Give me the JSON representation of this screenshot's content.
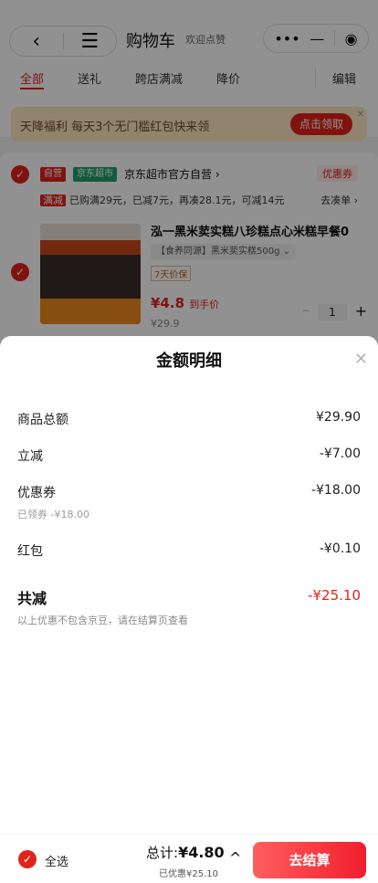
{
  "background": {
    "header": {
      "title": "购物车",
      "location": "欢迎点赞",
      "back_icon": "‹",
      "menu_icon": "☰",
      "capsule": {
        "more": "•••",
        "minimize": "—",
        "target": "◉"
      }
    },
    "tabs": [
      {
        "label": "全部",
        "active": true
      },
      {
        "label": "送礼",
        "active": false
      },
      {
        "label": "跨店满减",
        "active": false
      },
      {
        "label": "降价",
        "active": false
      }
    ],
    "edit_label": "编辑",
    "banner": {
      "text": "天降福利 每天3个无门槛红包快来领",
      "button": "点击领取",
      "close": "✕"
    },
    "store": {
      "tag_self": "自营",
      "tag_market": "京东超市",
      "name": "京东超市官方自营 ›",
      "coupon": "优惠券",
      "promo_tag": "满减",
      "promo_text": "已购满29元，已减7元，再凑28.1元，可减14元",
      "collect": "去凑单 ›"
    },
    "product": {
      "title": "泓一黑米荬实糕八珍糕点心米糕早餐0",
      "spec": "【食养同源】黑米荬实糕500g ⌄",
      "price_protect": "7天价保",
      "price": "¥4.8",
      "price_suffix": "到手价",
      "original": "¥29.9",
      "qty": "1",
      "minus": "−",
      "plus": "+"
    }
  },
  "sheet": {
    "title": "金额明细",
    "close_icon": "✕",
    "rows": [
      {
        "label": "商品总额",
        "value": "¥29.90"
      },
      {
        "label": "立减",
        "value": "-¥7.00"
      },
      {
        "label": "优惠券",
        "value": "-¥18.00",
        "sub": "已领券 -¥18.00"
      },
      {
        "label": "红包",
        "value": "-¥0.10"
      }
    ],
    "total_label": "共减",
    "total_value": "-¥25.10",
    "note": "以上优惠不包含京豆，请在结算页查看"
  },
  "bottom": {
    "select_all": "全选",
    "sum_prefix": "总计:",
    "sum_value": "¥4.80",
    "saved": "已优惠¥25.10",
    "chevron": "^",
    "checkout": "去结算"
  },
  "colors": {
    "accent": "#e2231a",
    "overlay": "rgba(0,0,0,0.43)"
  }
}
